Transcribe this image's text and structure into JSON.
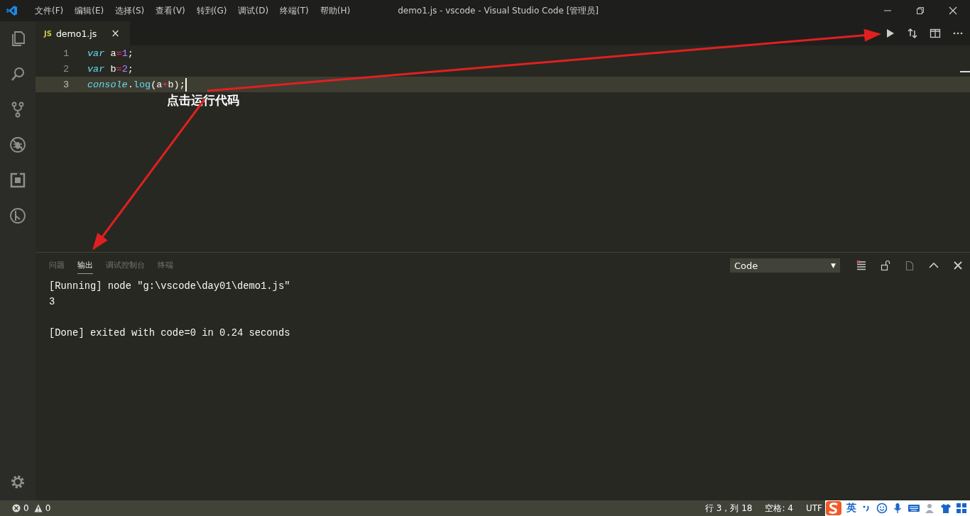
{
  "title_bar": {
    "menu": [
      "文件(F)",
      "编辑(E)",
      "选择(S)",
      "查看(V)",
      "转到(G)",
      "调试(D)",
      "终端(T)",
      "帮助(H)"
    ],
    "title": "demo1.js - vscode - Visual Studio Code [管理员]"
  },
  "activity_bar": {
    "items": [
      {
        "kind": "files",
        "selected": false
      },
      {
        "kind": "search",
        "selected": false
      },
      {
        "kind": "git",
        "selected": false
      },
      {
        "kind": "debug",
        "selected": false
      },
      {
        "kind": "extensions",
        "selected": false
      },
      {
        "kind": "timeline",
        "selected": false
      }
    ]
  },
  "tabs": [
    {
      "badge": "JS",
      "label": "demo1.js",
      "close": "×",
      "selected": true
    }
  ],
  "editor": {
    "lines": [
      {
        "number": "1",
        "current": false,
        "tokens": [
          {
            "kind": "keyword",
            "text": "var"
          },
          {
            "kind": "plain",
            "text": " a"
          },
          {
            "kind": "operator",
            "text": "="
          },
          {
            "kind": "number",
            "text": "1"
          },
          {
            "kind": "plain",
            "text": ";"
          }
        ]
      },
      {
        "number": "2",
        "current": false,
        "tokens": [
          {
            "kind": "keyword",
            "text": "var"
          },
          {
            "kind": "plain",
            "text": " b"
          },
          {
            "kind": "operator",
            "text": "="
          },
          {
            "kind": "number",
            "text": "2"
          },
          {
            "kind": "plain",
            "text": ";"
          }
        ]
      },
      {
        "number": "3",
        "current": true,
        "tokens": [
          {
            "kind": "builtin",
            "text": "console"
          },
          {
            "kind": "plain",
            "text": "."
          },
          {
            "kind": "function",
            "text": "log"
          },
          {
            "kind": "plain",
            "text": "(a"
          },
          {
            "kind": "operator",
            "text": "+"
          },
          {
            "kind": "plain",
            "text": "b);"
          }
        ]
      }
    ]
  },
  "annotation": {
    "text": "点击运行代码"
  },
  "panel": {
    "tabs": [
      {
        "label": "问题",
        "selected": false
      },
      {
        "label": "输出",
        "selected": true
      },
      {
        "label": "调试控制台",
        "selected": false
      },
      {
        "label": "终端",
        "selected": false
      }
    ],
    "dropdown": {
      "value": "Code",
      "caret": "▼"
    },
    "output_blocks": [
      {
        "lines": [
          "[Running] node \"g:\\vscode\\day01\\demo1.js\"",
          "3"
        ]
      },
      {
        "lines": [
          "[Done] exited with code=0 in 0.24 seconds"
        ]
      }
    ]
  },
  "status_bar": {
    "errors": "0",
    "warnings": "0",
    "position": "行 3，列 18",
    "indent": "空格: 4",
    "encoding": "UTF"
  },
  "ime_toolbar": {
    "label": "英"
  }
}
